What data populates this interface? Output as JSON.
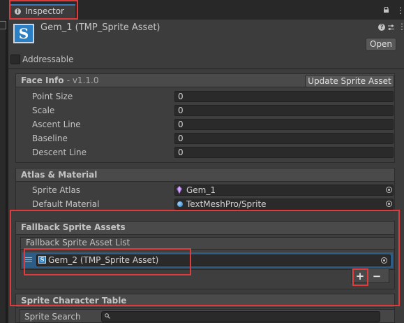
{
  "window": {
    "tab_label": "Inspector",
    "tab_icon": "info-icon",
    "lock_icon": "lock-icon",
    "menu_icon": "kebab-icon"
  },
  "header": {
    "title": "Gem_1 (TMP_Sprite Asset)",
    "asset_icon_letter": "S",
    "open_label": "Open"
  },
  "addressable": {
    "label": "Addressable",
    "checked": false
  },
  "face_info": {
    "title": "Face Info",
    "version": "- v1.1.0",
    "update_button": "Update Sprite Asset",
    "fields": [
      {
        "label": "Point Size",
        "value": "0"
      },
      {
        "label": "Scale",
        "value": "0"
      },
      {
        "label": "Ascent Line",
        "value": "0"
      },
      {
        "label": "Baseline",
        "value": "0"
      },
      {
        "label": "Descent Line",
        "value": "0"
      }
    ]
  },
  "atlas_material": {
    "title": "Atlas & Material",
    "sprite_atlas_label": "Sprite Atlas",
    "sprite_atlas_value": "Gem_1",
    "default_material_label": "Default Material",
    "default_material_value": "TextMeshPro/Sprite"
  },
  "fallback": {
    "title": "Fallback Sprite Assets",
    "list_header": "Fallback Sprite Asset List",
    "items": [
      {
        "value": "Gem_2 (TMP_Sprite Asset)"
      }
    ],
    "add_label": "+",
    "remove_label": "−"
  },
  "character_table": {
    "title": "Sprite Character Table",
    "search_label": "Sprite Search",
    "search_value": ""
  },
  "colors": {
    "accent_tab": "#3a79bb",
    "selected_row": "#2c5d87",
    "highlight": "#e03a3a",
    "asset_blue": "#2b7fc4"
  }
}
